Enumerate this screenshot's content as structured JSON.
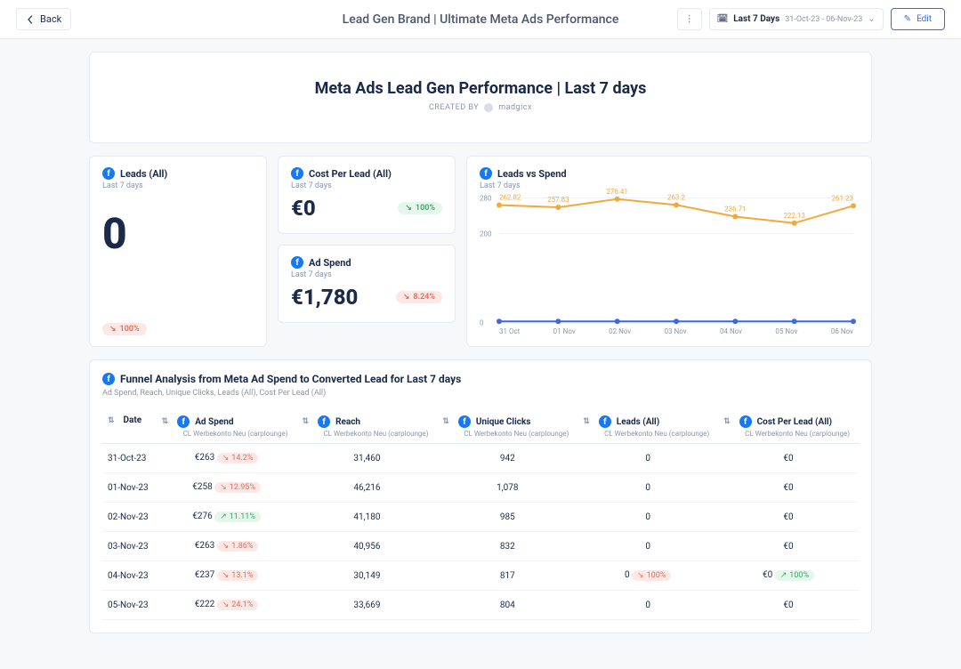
{
  "topbar": {
    "back_label": "Back",
    "title": "Lead Gen Brand | Ultimate Meta Ads Performance",
    "date_range_label": "Last 7 Days",
    "date_range_sub": "31-Oct-23 - 06-Nov-23",
    "edit_label": "Edit"
  },
  "hero": {
    "title": "Meta Ads Lead Gen Performance | Last 7 days",
    "created_by_label": "CREATED BY",
    "created_by_name": "madgicx"
  },
  "cards": {
    "leads": {
      "title": "Leads (All)",
      "subtitle": "Last 7 days",
      "value": "0",
      "delta_value": "100%",
      "delta_dir": "down"
    },
    "cpl": {
      "title": "Cost Per Lead (All)",
      "subtitle": "Last 7 days",
      "value": "€0",
      "delta_value": "100%",
      "delta_dir": "up"
    },
    "spend": {
      "title": "Ad Spend",
      "subtitle": "Last 7 days",
      "value": "€1,780",
      "delta_value": "8.24%",
      "delta_dir": "down"
    }
  },
  "chart": {
    "title": "Leads vs Spend",
    "subtitle": "Last 7 days"
  },
  "chart_data": {
    "type": "line",
    "title": "Leads vs Spend",
    "xlabel": "",
    "ylabel": "",
    "categories": [
      "31 Oct",
      "01 Nov",
      "02 Nov",
      "03 Nov",
      "04 Nov",
      "05 Nov",
      "06 Nov"
    ],
    "yticks": [
      0,
      200,
      280
    ],
    "series": [
      {
        "name": "Spend",
        "color": "#f2a83b",
        "values": [
          262.82,
          257.83,
          276.41,
          263.2,
          236.71,
          222.13,
          261.23
        ]
      },
      {
        "name": "Leads",
        "color": "#3b6ae0",
        "values": [
          0,
          0,
          0,
          0,
          0,
          0,
          0
        ]
      }
    ]
  },
  "funnel": {
    "title": "Funnel Analysis from Meta Ad Spend to Converted Lead for Last 7 days",
    "subtitle": "Ad Spend, Reach, Unique Clicks, Leads (All), Cost Per Lead (All)",
    "columns": [
      {
        "key": "date",
        "label": "Date",
        "has_fb": false,
        "sub": ""
      },
      {
        "key": "spend",
        "label": "Ad Spend",
        "has_fb": true,
        "sub": "CL Werbekonto Neu (carplounge)"
      },
      {
        "key": "reach",
        "label": "Reach",
        "has_fb": true,
        "sub": "CL Werbekonto Neu (carplounge)"
      },
      {
        "key": "clicks",
        "label": "Unique Clicks",
        "has_fb": true,
        "sub": "CL Werbekonto Neu (carplounge)"
      },
      {
        "key": "leads",
        "label": "Leads (All)",
        "has_fb": true,
        "sub": "CL Werbekonto Neu (carplounge)"
      },
      {
        "key": "cpl",
        "label": "Cost Per Lead (All)",
        "has_fb": true,
        "sub": "CL Werbekonto Neu (carplounge)"
      }
    ],
    "rows": [
      {
        "date": "31-Oct-23",
        "spend": "€263",
        "spend_delta": "14.2%",
        "spend_dir": "down",
        "reach": "31,460",
        "clicks": "942",
        "leads": "0",
        "leads_delta": "",
        "leads_dir": "",
        "cpl": "€0",
        "cpl_delta": "",
        "cpl_dir": ""
      },
      {
        "date": "01-Nov-23",
        "spend": "€258",
        "spend_delta": "12.95%",
        "spend_dir": "down",
        "reach": "46,216",
        "clicks": "1,078",
        "leads": "0",
        "leads_delta": "",
        "leads_dir": "",
        "cpl": "€0",
        "cpl_delta": "",
        "cpl_dir": ""
      },
      {
        "date": "02-Nov-23",
        "spend": "€276",
        "spend_delta": "11.11%",
        "spend_dir": "up",
        "reach": "41,180",
        "clicks": "985",
        "leads": "0",
        "leads_delta": "",
        "leads_dir": "",
        "cpl": "€0",
        "cpl_delta": "",
        "cpl_dir": ""
      },
      {
        "date": "03-Nov-23",
        "spend": "€263",
        "spend_delta": "1.86%",
        "spend_dir": "down",
        "reach": "40,956",
        "clicks": "832",
        "leads": "0",
        "leads_delta": "",
        "leads_dir": "",
        "cpl": "€0",
        "cpl_delta": "",
        "cpl_dir": ""
      },
      {
        "date": "04-Nov-23",
        "spend": "€237",
        "spend_delta": "13.1%",
        "spend_dir": "down",
        "reach": "30,149",
        "clicks": "817",
        "leads": "0",
        "leads_delta": "100%",
        "leads_dir": "down",
        "cpl": "€0",
        "cpl_delta": "100%",
        "cpl_dir": "up"
      },
      {
        "date": "05-Nov-23",
        "spend": "€222",
        "spend_delta": "24.1%",
        "spend_dir": "down",
        "reach": "33,669",
        "clicks": "804",
        "leads": "0",
        "leads_delta": "",
        "leads_dir": "",
        "cpl": "€0",
        "cpl_delta": "",
        "cpl_dir": ""
      }
    ]
  }
}
